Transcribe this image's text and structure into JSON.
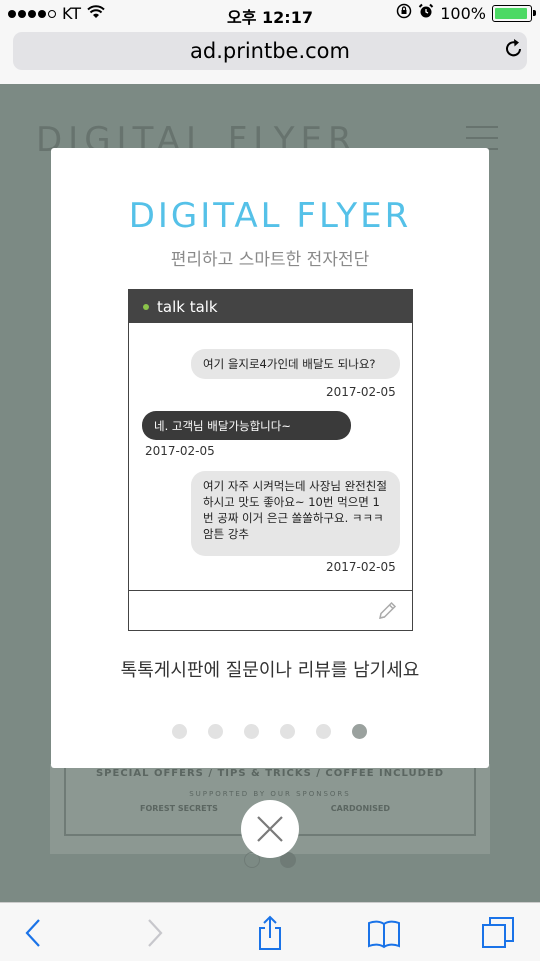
{
  "status": {
    "carrier": "KT",
    "time": "오후 12:17",
    "battery": "100%"
  },
  "browser": {
    "url": "ad.printbe.com"
  },
  "background_page": {
    "title": "DIGITAL FLYER",
    "card_line1": "SPECIAL OFFERS / TIPS & TRICKS / COFFEE INCLUDED",
    "card_line2": "SUPPORTED BY OUR SPONSORS",
    "card_line3": "FOREST SECRETS",
    "card_line4": "CARDONISED"
  },
  "modal": {
    "title": "DIGITAL FLYER",
    "subtitle": "편리하고 스마트한 전자전단",
    "chat_header": "talk talk",
    "messages": [
      {
        "text": "여기 을지로4가인데 배달도 되나요?",
        "date": "2017-02-05"
      },
      {
        "text": "네. 고객님 배달가능합니다~",
        "date": "2017-02-05"
      },
      {
        "text": "여기 자주 시켜먹는데 사장님 완전친절하시고 맛도 좋아요~ 10번 먹으면 1번 공짜 이거 은근 쏠쏠하구요. ㅋㅋㅋ 암튼 강추",
        "date": "2017-02-05"
      }
    ],
    "caption": "톡톡게시판에 질문이나 리뷰를 남기세요",
    "pager": {
      "count": 6,
      "active": 6
    }
  },
  "icons": {
    "wifi": "wifi-icon",
    "lock": "orientation-lock-icon",
    "alarm": "alarm-icon",
    "reload": "reload-icon",
    "pencil": "pencil-icon",
    "close": "close-icon",
    "back": "back-icon",
    "forward": "forward-icon",
    "share": "share-icon",
    "bookmarks": "bookmarks-icon",
    "tabs": "tabs-icon"
  }
}
